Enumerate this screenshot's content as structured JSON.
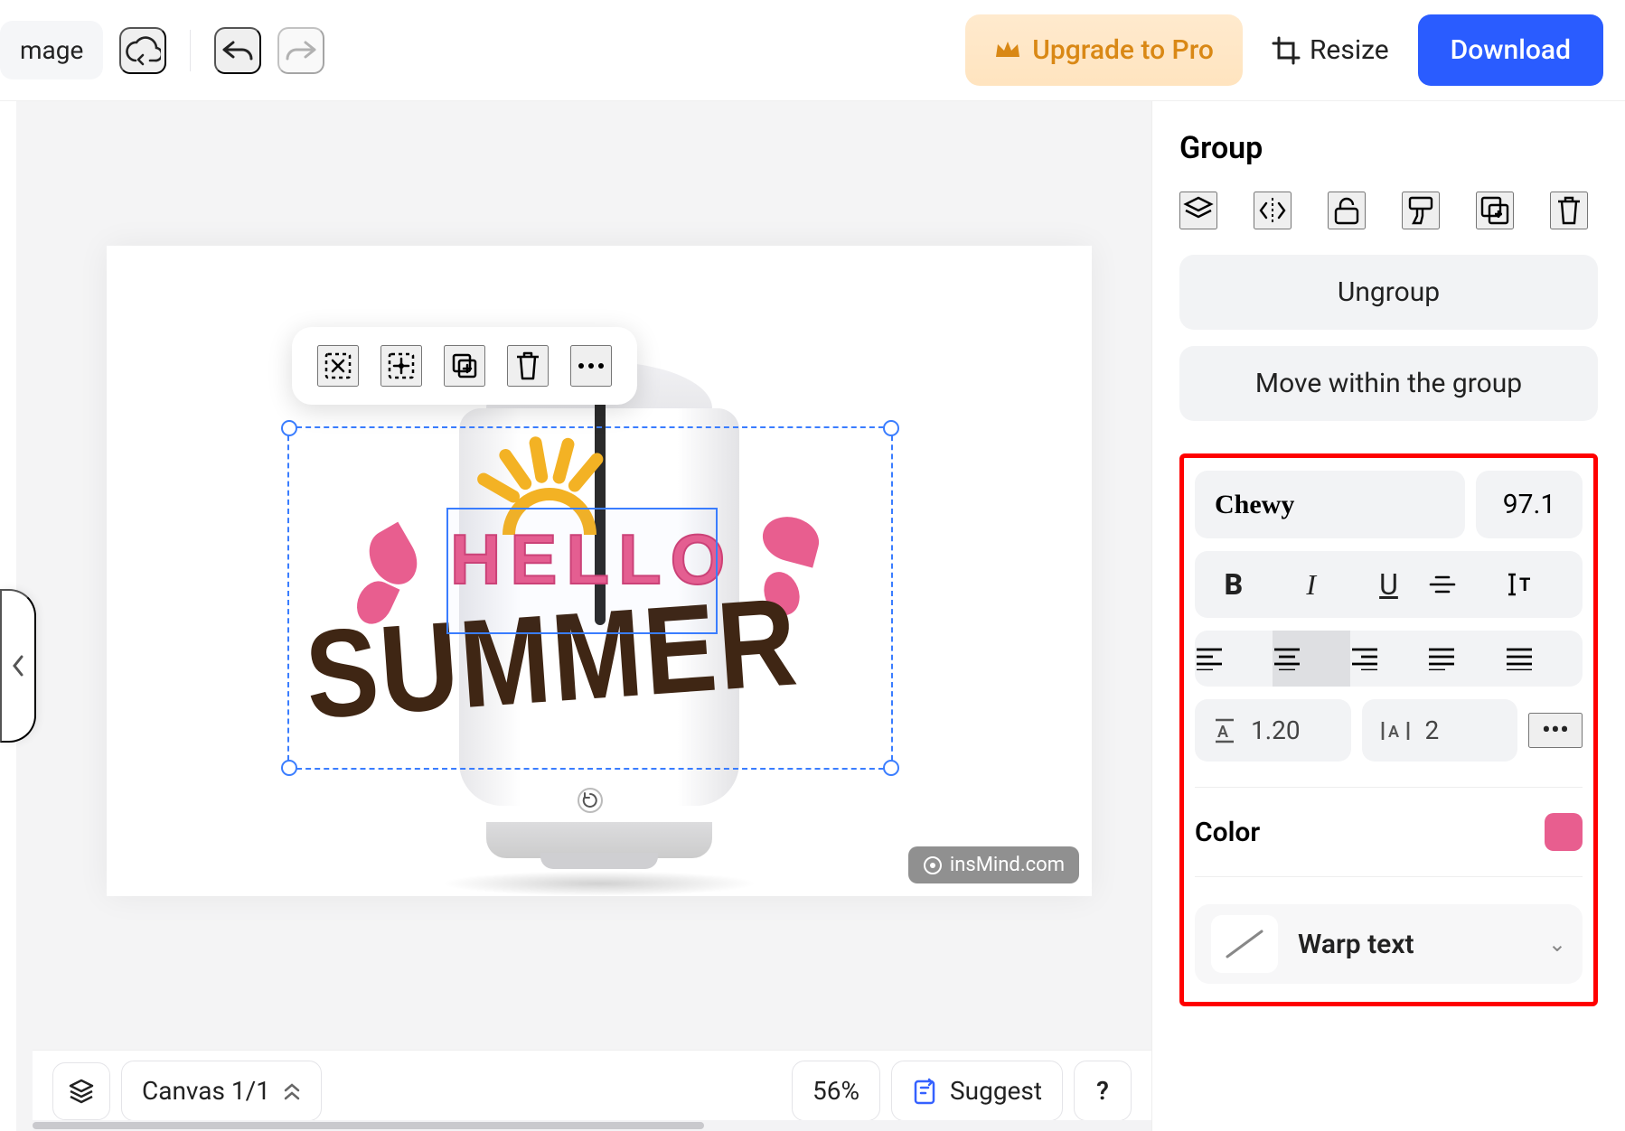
{
  "topbar": {
    "image_tab": "mage",
    "upgrade": "Upgrade to Pro",
    "resize": "Resize",
    "download": "Download"
  },
  "canvas": {
    "text_hello": "HELLO",
    "text_summer": "SUMMER",
    "watermark": "insMind.com"
  },
  "bottombar": {
    "canvas_label": "Canvas 1/1",
    "zoom": "56%",
    "suggest": "Suggest",
    "help": "?"
  },
  "panel": {
    "title": "Group",
    "ungroup": "Ungroup",
    "move_within": "Move within the group",
    "font_name": "Chewy",
    "font_size": "97.1",
    "line_height": "1.20",
    "letter_spacing": "2",
    "color_label": "Color",
    "color_value": "#e85e8f",
    "warp_label": "Warp text"
  }
}
